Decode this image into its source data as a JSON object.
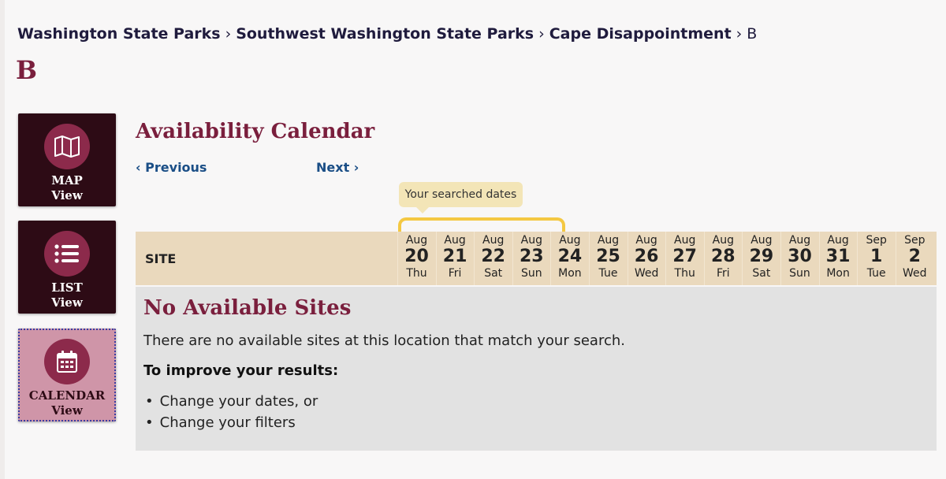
{
  "breadcrumb": {
    "items": [
      "Washington State Parks",
      "Southwest Washington State Parks",
      "Cape Disappointment"
    ],
    "separator": "›",
    "current": "B"
  },
  "page_title": "B",
  "views": {
    "map": {
      "line1": "MAP",
      "line2": "View",
      "icon": "map-icon"
    },
    "list": {
      "line1": "LIST",
      "line2": "View",
      "icon": "list-icon"
    },
    "calendar": {
      "line1": "CALENDAR",
      "line2": "View",
      "icon": "calendar-icon"
    }
  },
  "calendar": {
    "title": "Availability Calendar",
    "previous": "‹ Previous",
    "next": "Next ›",
    "tooltip": "Your searched dates",
    "site_header": "SITE",
    "days": [
      {
        "month": "Aug",
        "date": "20",
        "weekday": "Thu"
      },
      {
        "month": "Aug",
        "date": "21",
        "weekday": "Fri"
      },
      {
        "month": "Aug",
        "date": "22",
        "weekday": "Sat"
      },
      {
        "month": "Aug",
        "date": "23",
        "weekday": "Sun"
      },
      {
        "month": "Aug",
        "date": "24",
        "weekday": "Mon"
      },
      {
        "month": "Aug",
        "date": "25",
        "weekday": "Tue"
      },
      {
        "month": "Aug",
        "date": "26",
        "weekday": "Wed"
      },
      {
        "month": "Aug",
        "date": "27",
        "weekday": "Thu"
      },
      {
        "month": "Aug",
        "date": "28",
        "weekday": "Fri"
      },
      {
        "month": "Aug",
        "date": "29",
        "weekday": "Sat"
      },
      {
        "month": "Aug",
        "date": "30",
        "weekday": "Sun"
      },
      {
        "month": "Aug",
        "date": "31",
        "weekday": "Mon"
      },
      {
        "month": "Sep",
        "date": "1",
        "weekday": "Tue"
      },
      {
        "month": "Sep",
        "date": "2",
        "weekday": "Wed"
      }
    ]
  },
  "results": {
    "heading": "No Available Sites",
    "message": "There are no available sites at this location that match your search.",
    "improve_heading": "To improve your results:",
    "tips": [
      "Change your dates, or",
      "Change your filters"
    ]
  },
  "colors": {
    "brand": "#7a1f3d",
    "dark_button": "#2d0b15",
    "selected_button": "#cf95a8",
    "header_row": "#ead9bd",
    "highlight": "#f4c842"
  }
}
